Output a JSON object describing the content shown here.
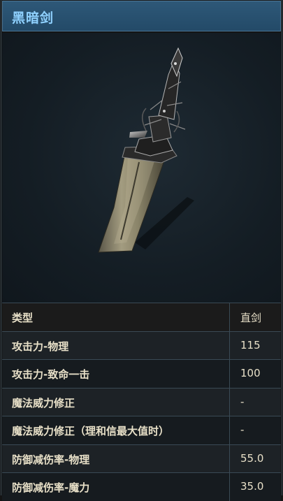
{
  "item": {
    "name": "黑暗剑",
    "image_icon": "dark-sword-icon"
  },
  "stats": {
    "header": {
      "label": "类型",
      "value": "直剑"
    },
    "rows": [
      {
        "label": "攻击力-物理",
        "value": "115"
      },
      {
        "label": "攻击力-致命一击",
        "value": "100"
      },
      {
        "label": "魔法威力修正",
        "value": "-"
      },
      {
        "label": "魔法威力修正（理和信最大值时）",
        "value": "-"
      },
      {
        "label": "防御减伤率-物理",
        "value": "55.0"
      },
      {
        "label": "防御减伤率-魔力",
        "value": "35.0"
      }
    ]
  },
  "colors": {
    "title_bg": "#2b5575",
    "title_text": "#8fd1ff",
    "cell_text": "#e8e0c8",
    "border": "#3a4a55"
  }
}
